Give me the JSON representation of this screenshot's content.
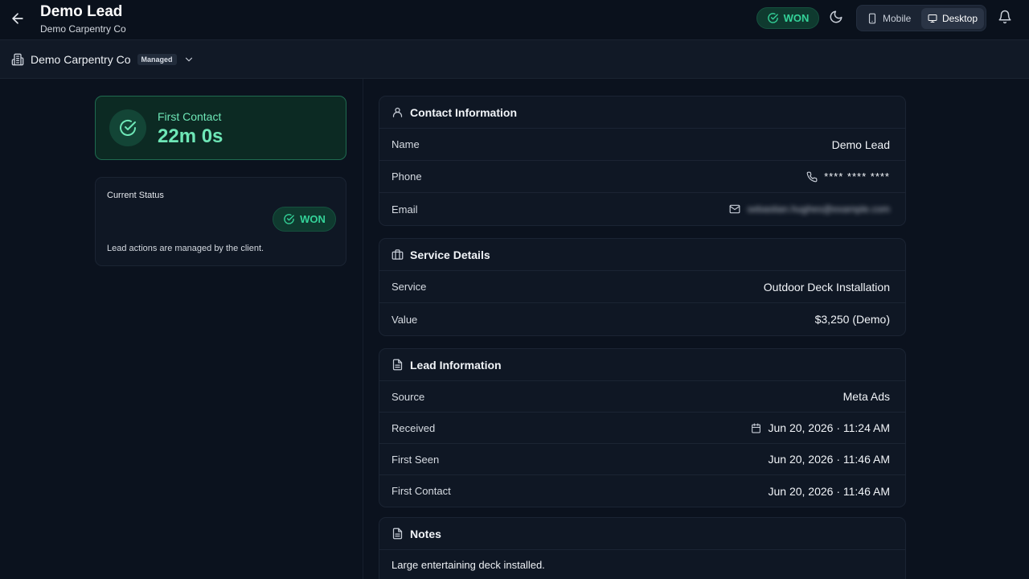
{
  "header": {
    "title": "Demo Lead",
    "subtitle": "Demo Carpentry Co",
    "status_badge": "WON",
    "view_options": [
      "Mobile",
      "Desktop"
    ],
    "active_view": "Desktop",
    "icons": [
      "arrow-left-icon",
      "moon-icon",
      "smartphone-icon",
      "monitor-icon",
      "bell-icon"
    ]
  },
  "company_bar": {
    "name": "Demo Carpentry Co",
    "badge": "Managed"
  },
  "first_contact": {
    "label": "First Contact",
    "value": "22m 0s"
  },
  "status_card": {
    "label": "Current Status",
    "status": "WON",
    "note": "Lead actions are managed by the client."
  },
  "contact": {
    "title": "Contact Information",
    "rows": [
      {
        "label": "Name",
        "value": "Demo Lead"
      },
      {
        "label": "Phone",
        "value": "**** **** ****"
      },
      {
        "label": "Email",
        "value": "sebastian.hughes@example.com"
      }
    ]
  },
  "service": {
    "title": "Service Details",
    "rows": [
      {
        "label": "Service",
        "value": "Outdoor Deck Installation"
      },
      {
        "label": "Value",
        "value": "$3,250 (Demo)"
      }
    ]
  },
  "lead": {
    "title": "Lead Information",
    "rows": [
      {
        "label": "Source",
        "value": "Meta Ads"
      },
      {
        "label": "Received",
        "value": "Jun 20, 2026 · 11:24 AM"
      },
      {
        "label": "First Seen",
        "value": "Jun 20, 2026 · 11:46 AM"
      },
      {
        "label": "First Contact",
        "value": "Jun 20, 2026 · 11:46 AM"
      }
    ]
  },
  "notes": {
    "title": "Notes",
    "text": "Large entertaining deck installed."
  },
  "colors": {
    "background": "#0b121e",
    "accent_green": "#34d399",
    "card": "#0f1724"
  }
}
